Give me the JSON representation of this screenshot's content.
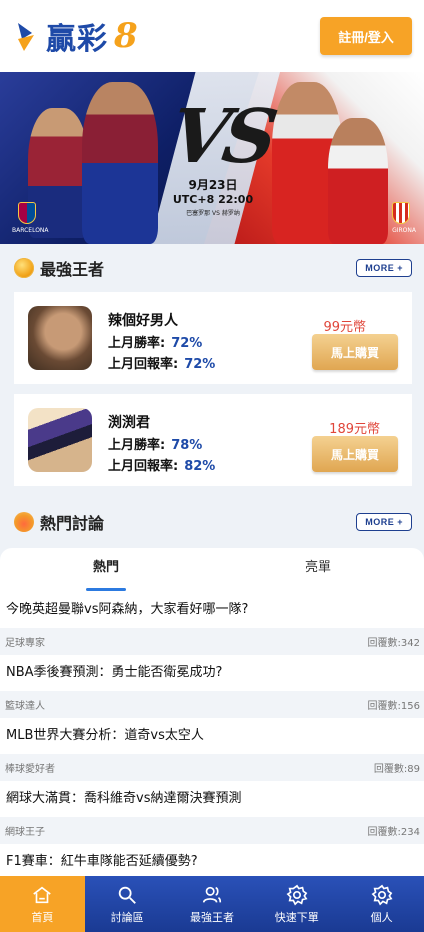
{
  "header": {
    "logo_text": "贏彩",
    "logo_num": "8",
    "register_label": "註冊/登入"
  },
  "banner": {
    "date": "9月23日",
    "time": "UTC+8 22:00",
    "teams": "巴塞罗那 VS 赫罗纳",
    "vs_text": "VS",
    "left_club": "BARCELONA",
    "right_club": "GIRONA"
  },
  "kings_section": {
    "title": "最強王者",
    "more_label": "MORE +",
    "cards": [
      {
        "name": "辣個好男人",
        "win_label": "上月勝率:",
        "win_rate": "72%",
        "return_label": "上月回報率:",
        "return_rate": "72%",
        "price": "99元幣",
        "buy_label": "馬上購買"
      },
      {
        "name": "渕渕君",
        "win_label": "上月勝率:",
        "win_rate": "78%",
        "return_label": "上月回報率:",
        "return_rate": "82%",
        "price": "189元幣",
        "buy_label": "馬上購買"
      }
    ]
  },
  "discussion_section": {
    "title": "熱門討論",
    "more_label": "MORE +",
    "tabs": [
      "熱門",
      "亮單"
    ],
    "posts": [
      {
        "title": "今晚英超曼聯vs阿森納，大家看好哪一隊?",
        "author": "足球專家",
        "replies": "回覆數:342"
      },
      {
        "title": "NBA季後賽預測：勇士能否衛冕成功?",
        "author": "籃球達人",
        "replies": "回覆數:156"
      },
      {
        "title": "MLB世界大賽分析：道奇vs太空人",
        "author": "棒球愛好者",
        "replies": "回覆數:89"
      },
      {
        "title": "網球大滿貫：喬科維奇vs納達爾決賽預測",
        "author": "網球王子",
        "replies": "回覆數:234"
      },
      {
        "title": "F1賽車：紅牛車隊能否延續優勢?",
        "author": "",
        "replies": ""
      }
    ]
  },
  "bottom_nav": {
    "items": [
      {
        "label": "首頁",
        "icon": "home-icon"
      },
      {
        "label": "討論區",
        "icon": "search-icon"
      },
      {
        "label": "最強王者",
        "icon": "users-icon"
      },
      {
        "label": "快速下單",
        "icon": "gear-icon"
      },
      {
        "label": "個人",
        "icon": "gear-icon"
      }
    ]
  },
  "colors": {
    "brand_blue": "#1e4aa8",
    "accent_orange": "#f7a326",
    "price_red": "#e0463a"
  }
}
